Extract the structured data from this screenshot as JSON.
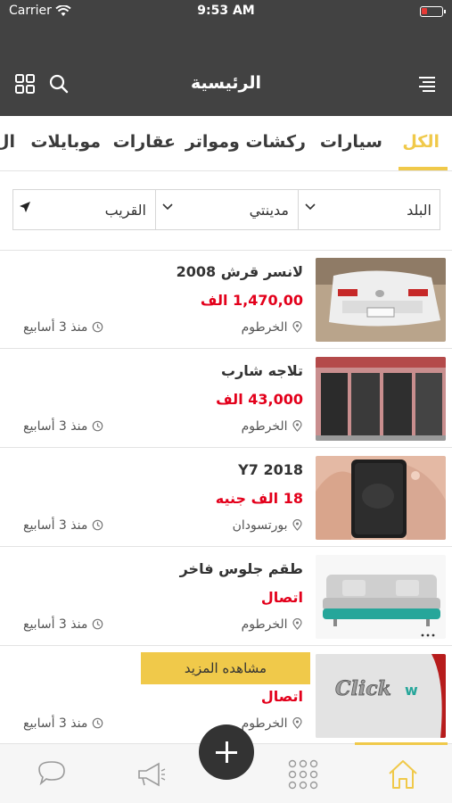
{
  "status_bar": {
    "carrier": "Carrier",
    "time": "9:53 AM"
  },
  "header": {
    "title": "الرئيسية"
  },
  "tabs": [
    {
      "label": "الكل",
      "active": true
    },
    {
      "label": "سيارات"
    },
    {
      "label": "ركشات ومواتر"
    },
    {
      "label": "عقارات"
    },
    {
      "label": "موبايلات"
    },
    {
      "label": "ال"
    }
  ],
  "filters": {
    "country": "البلد",
    "city": "مدينتي",
    "nearby": "القريب"
  },
  "listings": [
    {
      "title": "لانسر قرش 2008",
      "price": "1,470,00 الف",
      "location": "الخرطوم",
      "time": "منذ 3 أسابيع"
    },
    {
      "title": "تلاجه شارب",
      "price": "43,000 الف",
      "location": "الخرطوم",
      "time": "منذ 3 أسابيع"
    },
    {
      "title": "Y7 2018",
      "price": "18 الف جنيه",
      "location": "بورتسودان",
      "time": "منذ 3 أسابيع"
    },
    {
      "title": "طقم جلوس فاخر",
      "price": "اتصال",
      "location": "الخرطوم",
      "time": "منذ 3 أسابيع"
    },
    {
      "title": "",
      "price": "اتصال",
      "location": "الخرطوم",
      "time": "منذ 3 أسابيع"
    }
  ],
  "more_button": "مشاهده المزيد",
  "colors": {
    "header_bg": "#424242",
    "accent": "#f0c94a",
    "price": "#e3001b"
  }
}
